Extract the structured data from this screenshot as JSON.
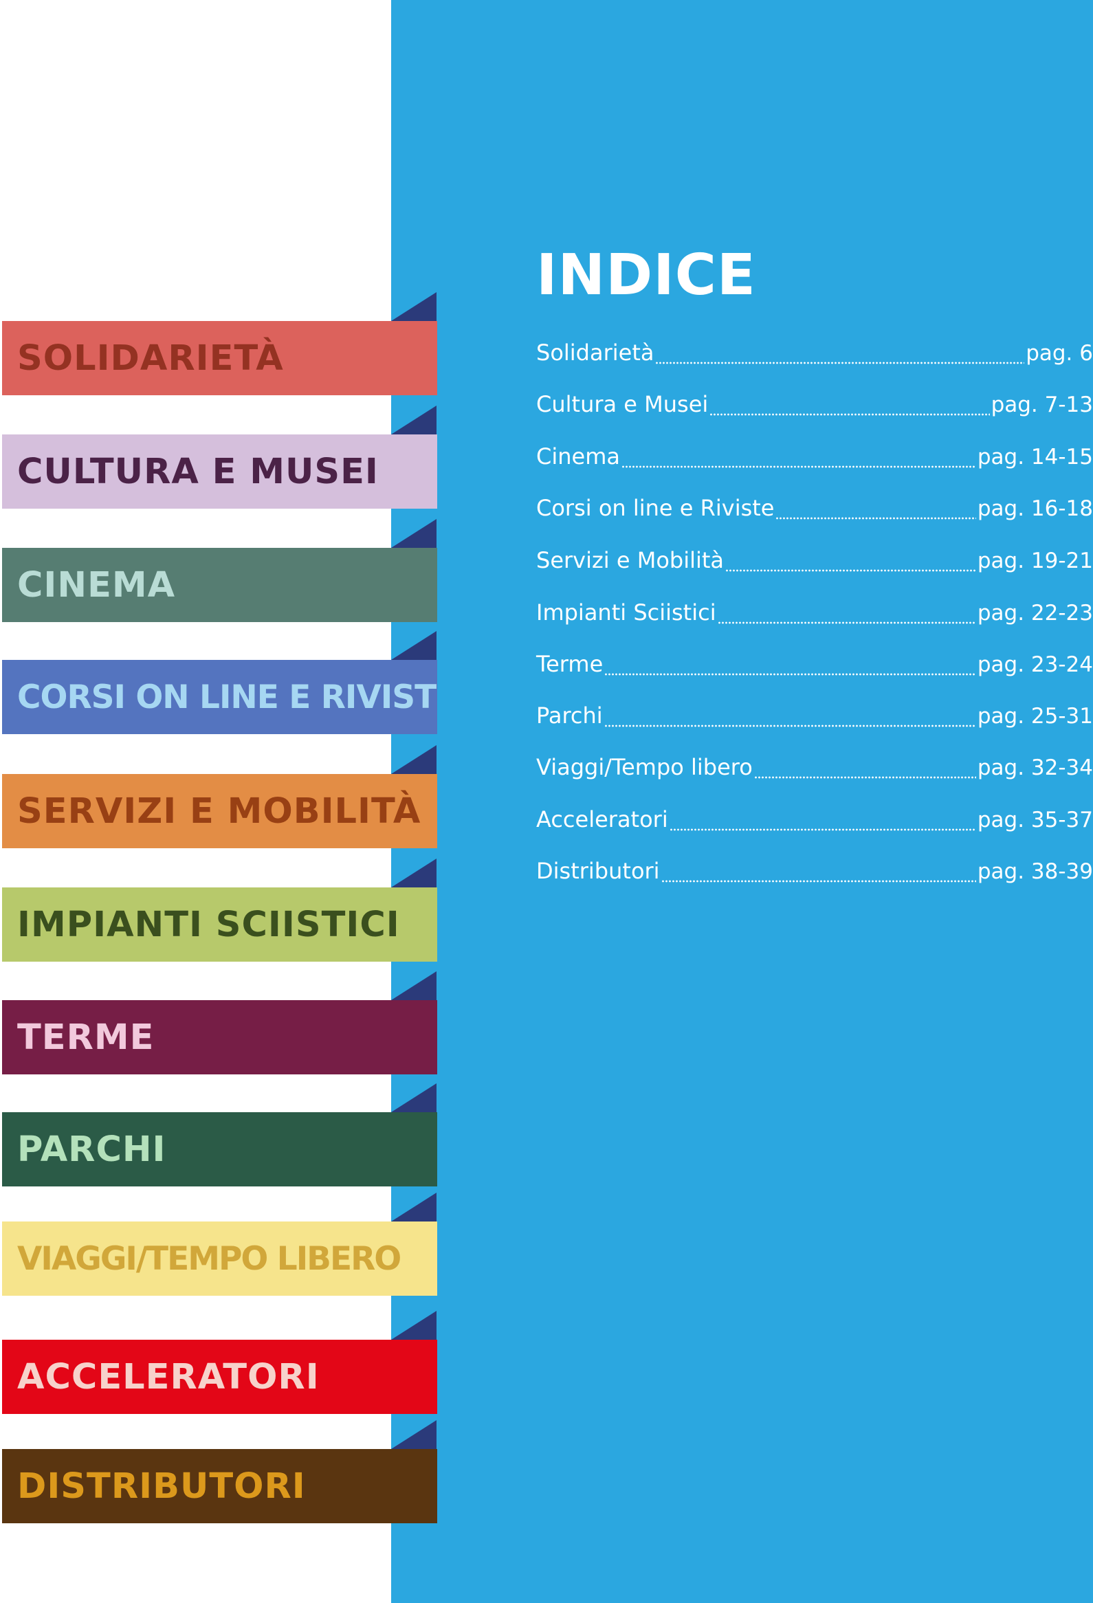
{
  "index": {
    "title": "INDICE",
    "entries": [
      {
        "label": "Solidarietà",
        "page": "pag. 6"
      },
      {
        "label": "Cultura e Musei",
        "page": "pag. 7-13"
      },
      {
        "label": "Cinema",
        "page": "pag. 14-15"
      },
      {
        "label": "Corsi on line e Riviste",
        "page": "pag. 16-18"
      },
      {
        "label": "Servizi e Mobilità",
        "page": "pag. 19-21"
      },
      {
        "label": "Impianti Sciistici",
        "page": "pag. 22-23"
      },
      {
        "label": "Terme",
        "page": "pag. 23-24"
      },
      {
        "label": "Parchi",
        "page": "pag. 25-31"
      },
      {
        "label": "Viaggi/Tempo libero",
        "page": "pag. 32-34"
      },
      {
        "label": "Acceleratori",
        "page": "pag. 35-37"
      },
      {
        "label": "Distributori",
        "page": "pag. 38-39"
      }
    ]
  },
  "tabs": [
    {
      "label": "SOLIDARIETÀ",
      "bg": "#dc625c",
      "fg": "#943222"
    },
    {
      "label": "CULTURA E MUSEI",
      "bg": "#d5bfdc",
      "fg": "#4b2247"
    },
    {
      "label": "CINEMA",
      "bg": "#567d72",
      "fg": "#b9dcd5"
    },
    {
      "label": "CORSI ON LINE E RIVISTE",
      "bg": "#5474bf",
      "fg": "#a6d7f2"
    },
    {
      "label": "SERVIZI E MOBILITÀ",
      "bg": "#e38d45",
      "fg": "#984014"
    },
    {
      "label": "IMPIANTI SCIISTICI",
      "bg": "#b7c96b",
      "fg": "#3a4f1e"
    },
    {
      "label": "TERME",
      "bg": "#761e46",
      "fg": "#f2c9dc"
    },
    {
      "label": "PARCHI",
      "bg": "#2b5b47",
      "fg": "#b4e1bb"
    },
    {
      "label": "VIAGGI/TEMPO LIBERO",
      "bg": "#f6e48c",
      "fg": "#d1a73a"
    },
    {
      "label": "ACCELERATORI",
      "bg": "#e30617",
      "fg": "#f7d2cb"
    },
    {
      "label": "DISTRIBUTORI",
      "bg": "#5a3510",
      "fg": "#dc991c"
    }
  ],
  "colors": {
    "panel": "#2ba7e0",
    "fold": "#2b3a7a",
    "text": "#ffffff"
  }
}
